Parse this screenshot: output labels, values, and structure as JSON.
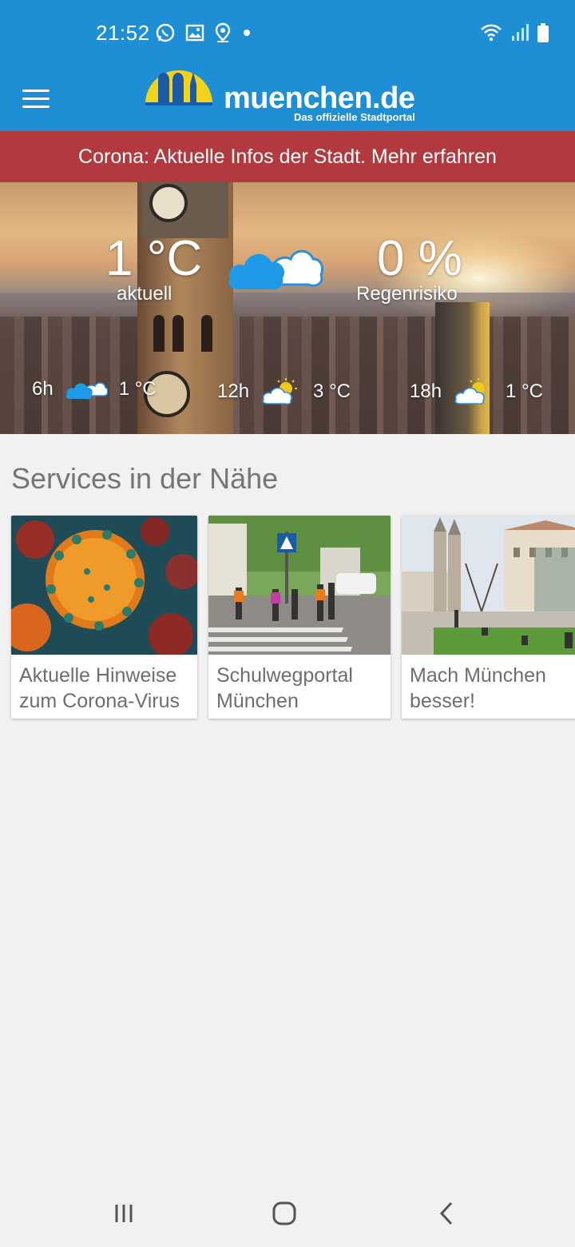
{
  "status_bar": {
    "time": "21:52",
    "left_icons": [
      "whatsapp-icon",
      "gallery-icon",
      "location-icon",
      "dot-icon"
    ],
    "right_icons": [
      "wifi-icon",
      "signal-icon",
      "battery-icon"
    ]
  },
  "app_bar": {
    "menu_icon": "hamburger-menu-icon",
    "logo_text": "muenchen.de",
    "logo_subtitle": "Das offizielle Stadtportal"
  },
  "corona_banner": {
    "text": "Corona: Aktuelle Infos der Stadt. Mehr erfahren",
    "color": "#b23a3f"
  },
  "weather": {
    "current_temp": "1 °C",
    "current_label": "aktuell",
    "current_icon": "cloudy-icon",
    "rain_value": "0 %",
    "rain_label": "Regenrisiko",
    "forecast": [
      {
        "hour": "6h",
        "icon": "cloudy-icon",
        "temp": "1 °C"
      },
      {
        "hour": "12h",
        "icon": "partly-sunny-icon",
        "temp": "3 °C"
      },
      {
        "hour": "18h",
        "icon": "partly-sunny-icon",
        "temp": "1 °C"
      }
    ]
  },
  "services": {
    "title": "Services in der Nähe",
    "cards": [
      {
        "title": "Aktuelle Hinweise zum Corona-Virus",
        "image": "coronavirus-image"
      },
      {
        "title": "Schulwegportal München",
        "image": "school-crossing-image"
      },
      {
        "title": "Mach München besser!",
        "image": "munich-square-image"
      }
    ]
  },
  "nav_bar": {
    "buttons": [
      "recent-apps-icon",
      "home-icon",
      "back-icon"
    ]
  },
  "colors": {
    "primary": "#1e8fd5",
    "banner": "#b23a3f",
    "background": "#f1f1f1"
  }
}
